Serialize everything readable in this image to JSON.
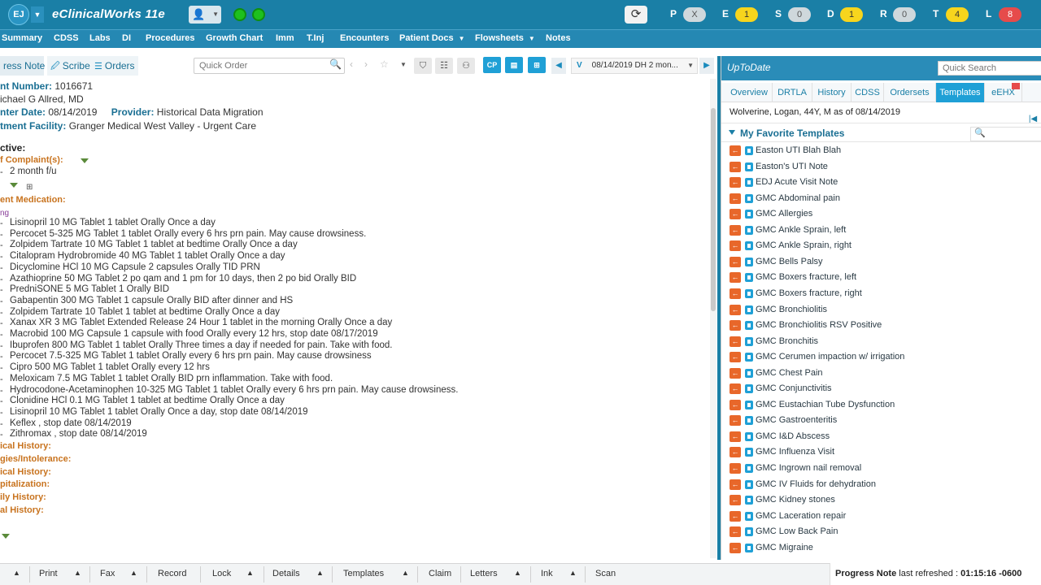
{
  "titlebar": {
    "logo": "EJ",
    "app_title": "eClinicalWorks 11e",
    "patient_icon": "person-search",
    "refresh_icon": "refresh-icon",
    "counters": [
      {
        "letter": "P",
        "value": "X",
        "color": "#cfd8dc"
      },
      {
        "letter": "E",
        "value": "1",
        "color": "#f7d51d"
      },
      {
        "letter": "S",
        "value": "0",
        "color": "#cfd8dc"
      },
      {
        "letter": "D",
        "value": "1",
        "color": "#f7d51d"
      },
      {
        "letter": "R",
        "value": "0",
        "color": "#cfd8dc"
      },
      {
        "letter": "T",
        "value": "4",
        "color": "#f7d51d"
      },
      {
        "letter": "L",
        "value": "8",
        "color": "#e64b4b"
      }
    ]
  },
  "nav": {
    "items": [
      "Summary",
      "CDSS",
      "Labs",
      "DI",
      "Procedures",
      "Growth Chart",
      "Imm",
      "T.Inj",
      "Encounters",
      "Patient Docs",
      "Flowsheets",
      "Notes"
    ]
  },
  "toolbar": {
    "progress_note": "ress Note",
    "scribe": "Scribe",
    "orders": "Orders",
    "quick_order_placeholder": "Quick Order",
    "cp": "CP",
    "visit_prefix": "V",
    "visit_label": "08/14/2019 DH 2 mon..."
  },
  "note": {
    "account_label": "nt Number:",
    "account_value": "1016671",
    "patient_provider": "ichael G Allred, MD",
    "enc_date_label": "nter Date:",
    "enc_date_value": "08/14/2019",
    "provider_label": "Provider:",
    "provider_value": "Historical Data Migration",
    "facility_label": "tment Facility:",
    "facility_value": "Granger Medical West Valley - Urgent Care",
    "subjective": "ctive:",
    "complaints_label": "f Complaint(s):",
    "complaint": "2 month f/u",
    "current_med_label": "ent Medication:",
    "taking": "ng",
    "medications": [
      "Lisinopril 10 MG Tablet 1 tablet Orally Once a day",
      "Percocet 5-325 MG Tablet 1 tablet Orally every 6 hrs prn pain. May cause drowsiness.",
      "Zolpidem Tartrate 10 MG Tablet 1 tablet at bedtime Orally Once a day",
      "Citalopram Hydrobromide 40 MG Tablet 1 tablet Orally Once a day",
      "Dicyclomine HCl 10 MG Capsule 2 capsules Orally TID PRN",
      "Azathioprine 50 MG Tablet 2 po qam and 1 pm for 10 days, then 2 po bid Orally BID",
      "PredniSONE 5 MG Tablet 1 Orally BID",
      "Gabapentin 300 MG Tablet 1 capsule Orally BID after dinner and HS",
      "Zolpidem Tartrate 10 Tablet 1 tablet at bedtime Orally Once a day",
      "Xanax XR 3 MG Tablet Extended Release 24 Hour 1 tablet in the morning Orally Once a day",
      "Macrobid 100 MG Capsule 1 capsule with food Orally every 12 hrs, stop date 08/17/2019",
      "Ibuprofen 800 MG Tablet 1 tablet Orally Three times a day if needed for pain. Take with food.",
      "Percocet 7.5-325 MG Tablet 1 tablet Orally every 6 hrs prn pain. May cause drowsiness",
      "Cipro 500 MG Tablet 1 tablet Orally every 12 hrs",
      "Meloxicam 7.5 MG Tablet 1 tablet Orally BID prn inflammation. Take with food.",
      "Hydrocodone-Acetaminophen 10-325 MG Tablet 1 tablet Orally every 6 hrs prn pain. May cause drowsiness.",
      "Clonidine HCl 0.1 MG Tablet 1 tablet at bedtime Orally Once a day",
      "Lisinopril 10 MG Tablet 1 tablet Orally Once a day, stop date 08/14/2019",
      "Keflex , stop date 08/14/2019",
      "Zithromax , stop date 08/14/2019"
    ],
    "sections": [
      "ical History:",
      "gies/Intolerance:",
      "ical History:",
      "pitalization:",
      "ily History:",
      "al History:"
    ]
  },
  "uptodate": {
    "title": "UpToDate",
    "search_placeholder": "Quick Search",
    "tabs": [
      "Overview",
      "DRTLA",
      "History",
      "CDSS",
      "Ordersets",
      "Templates",
      "eEHX"
    ],
    "active_tab": "Templates",
    "patient_line": "Wolverine, Logan, 44Y, M as of 08/14/2019",
    "favorites_title": "My Favorite Templates",
    "templates": [
      "Easton UTI Blah Blah",
      "Easton's UTI Note",
      "EDJ Acute Visit Note",
      "GMC Abdominal pain",
      "GMC Allergies",
      "GMC Ankle Sprain, left",
      "GMC Ankle Sprain, right",
      "GMC Bells Palsy",
      "GMC Boxers fracture, left",
      "GMC Boxers fracture, right",
      "GMC Bronchiolitis",
      "GMC Bronchiolitis RSV Positive",
      "GMC Bronchitis",
      "GMC Cerumen impaction w/ irrigation",
      "GMC Chest Pain",
      "GMC Conjunctivitis",
      "GMC Eustachian Tube Dysfunction",
      "GMC Gastroenteritis",
      "GMC I&D Abscess",
      "GMC Influenza Visit",
      "GMC Ingrown nail removal",
      "GMC IV Fluids for dehydration",
      "GMC Kidney stones",
      "GMC Laceration repair",
      "GMC Low Back Pain",
      "GMC Migraine"
    ]
  },
  "bottombar": {
    "buttons": [
      "Print",
      "Fax",
      "Record",
      "Lock",
      "Details",
      "Templates",
      "Claim",
      "Letters",
      "Ink",
      "Scan"
    ],
    "refreshed_label": "Progress Note",
    "refreshed_text": "last refreshed :",
    "refreshed_time": "01:15:16 -0600"
  }
}
